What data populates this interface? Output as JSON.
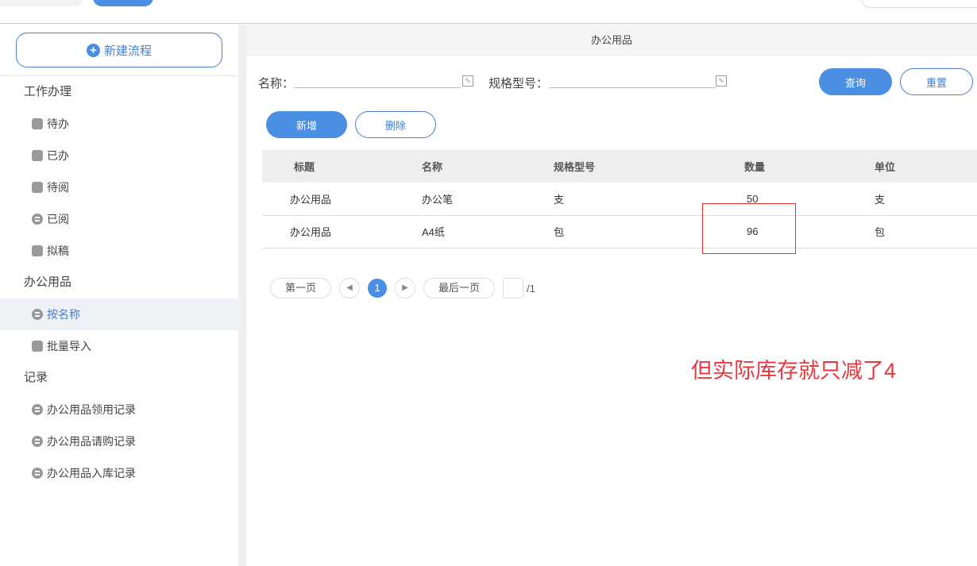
{
  "sidebar": {
    "new_button": "新建流程",
    "groups": [
      {
        "label": "工作办理",
        "items": [
          "待办",
          "已办",
          "待阅",
          "已阅",
          "拟稿"
        ]
      },
      {
        "label": "办公用品",
        "items": [
          "按名称",
          "批量导入"
        ]
      },
      {
        "label": "记录",
        "items": [
          "办公用品领用记录",
          "办公用品请购记录",
          "办公用品入库记录"
        ]
      }
    ],
    "active_item": "按名称"
  },
  "main": {
    "title": "办公用品",
    "search": {
      "name_label": "名称：",
      "name_value": "",
      "spec_label": "规格型号：",
      "spec_value": "",
      "query": "查询",
      "reset": "重置"
    },
    "actions": {
      "add": "新增",
      "delete": "删除"
    },
    "table": {
      "columns": [
        "标题",
        "名称",
        "规格型号",
        "数量",
        "单位"
      ],
      "rows": [
        [
          "办公用品",
          "办公笔",
          "支",
          "50",
          "支"
        ],
        [
          "办公用品",
          "A4纸",
          "包",
          "96",
          "包"
        ]
      ]
    },
    "pager": {
      "first": "第一页",
      "current": "1",
      "last": "最后一页",
      "total": "/1"
    }
  },
  "annotation": {
    "text": "但实际库存就只减了4",
    "color": "#e8383d"
  }
}
